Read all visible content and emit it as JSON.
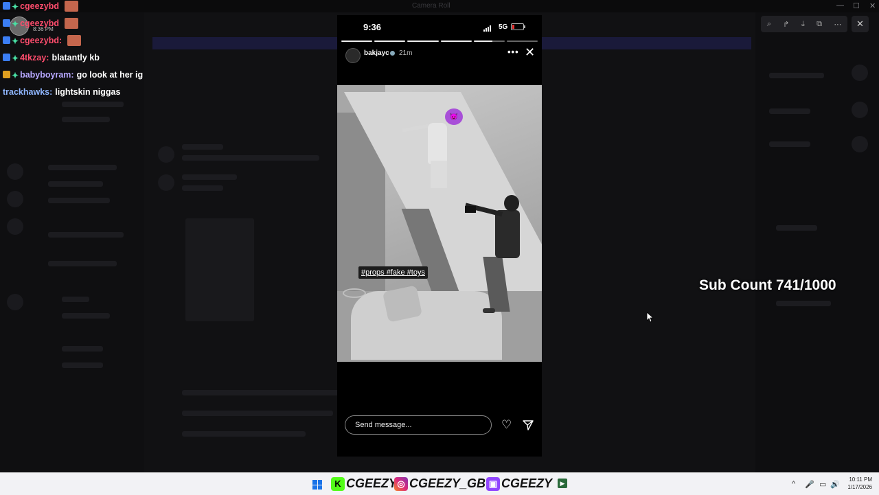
{
  "window": {
    "title": "Camera Roll",
    "controls": {
      "minimize": "—",
      "maximize": "☐",
      "close": "✕"
    }
  },
  "chat": {
    "stream_time": "8:36 PM",
    "messages": [
      {
        "user": "cgeezybd",
        "text": "",
        "color": "#ff4d6d",
        "badge": "blue"
      },
      {
        "user": "cgeezybd",
        "text": "",
        "color": "#ff4d6d",
        "badge": "blue"
      },
      {
        "user": "cgeezybd:",
        "text": "",
        "color": "#ff4d6d",
        "badge": "blue"
      },
      {
        "user": "4tkzay:",
        "text": "blatantly kb",
        "color": "#ff4d6d",
        "badge": "blue"
      },
      {
        "user": "babyboyram:",
        "text": "go look at her ig",
        "color": "#b7a8ff",
        "badge": "gold"
      },
      {
        "user": "trackhawks:",
        "text": "lightskin niggas",
        "color": "#8fb6ff",
        "badge": ""
      }
    ]
  },
  "overlay": {
    "sub_count": "Sub Count 741/1000"
  },
  "viewer_toolbar": {
    "icons": [
      "zoom-icon",
      "share-icon",
      "download-icon",
      "open-external-icon",
      "more-icon"
    ],
    "glyphs": [
      "⌕",
      "↱",
      "⤓",
      "⧉",
      "⋯"
    ],
    "close": "✕"
  },
  "phone": {
    "time": "9:36",
    "network": "5G",
    "story": {
      "username": "bakjayc",
      "posted": "21m",
      "more": "•••",
      "close": "✕",
      "segments_total": 6,
      "segments_done": 4,
      "hashtags": "#props #fake #toys",
      "sticker": "😈"
    },
    "message": {
      "placeholder": "Send message...",
      "value": ""
    }
  },
  "taskbar": {
    "kick": {
      "icon": "K",
      "handle": "CGEEZY"
    },
    "instagram": {
      "icon": "◎",
      "handle": "CGEEZY_GBC"
    },
    "twitch": {
      "icon": "▣",
      "handle": "CGEEZY"
    },
    "tray": {
      "chevron": "^",
      "mic": "🎤",
      "display": "▭",
      "volume": "🔊"
    },
    "clock_time": "10:11 PM",
    "clock_date": "1/17/2026"
  }
}
